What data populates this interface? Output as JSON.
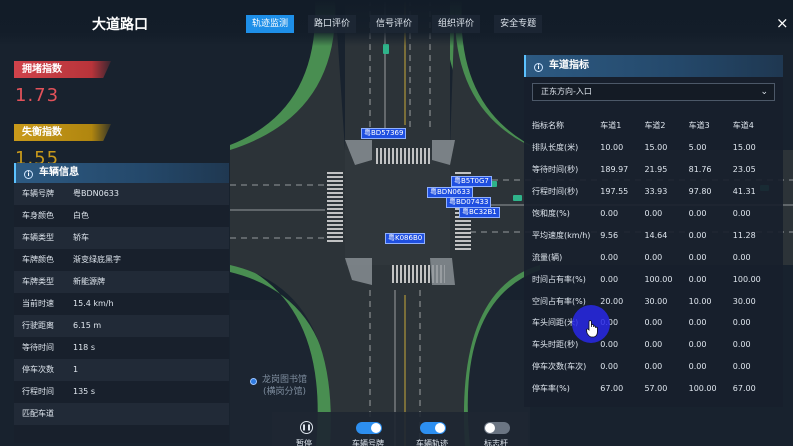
{
  "header": {
    "title": "大道路口",
    "tabs": [
      {
        "label": "轨迹监测",
        "active": true
      },
      {
        "label": "路口评价",
        "active": false
      },
      {
        "label": "信号评价",
        "active": false
      },
      {
        "label": "组织评价",
        "active": false
      },
      {
        "label": "安全专题",
        "active": false
      }
    ],
    "close_icon": "×"
  },
  "indices": {
    "congestion": {
      "label": "拥堵指数",
      "value": "1.73",
      "color": "#e2525a"
    },
    "imbalance": {
      "label": "失衡指数",
      "value": "1.55",
      "color": "#c99a1b"
    }
  },
  "vehicle_info": {
    "title": "车辆信息",
    "rows": [
      {
        "k": "车辆号牌",
        "v": "粤BDN0633"
      },
      {
        "k": "车身颜色",
        "v": "白色"
      },
      {
        "k": "车辆类型",
        "v": "轿车"
      },
      {
        "k": "车牌颜色",
        "v": "渐变绿底黑字"
      },
      {
        "k": "车牌类型",
        "v": "新能源牌"
      },
      {
        "k": "当前时速",
        "v": "15.4 km/h"
      },
      {
        "k": "行驶距离",
        "v": "6.15 m"
      },
      {
        "k": "等待时间",
        "v": "118 s"
      },
      {
        "k": "停车次数",
        "v": "1"
      },
      {
        "k": "行程时间",
        "v": "135 s"
      },
      {
        "k": "匹配车道",
        "v": ""
      }
    ]
  },
  "lane_panel": {
    "title": "车道指标",
    "direction": "正东方向-入口",
    "columns": [
      "指标名称",
      "车道1",
      "车道2",
      "车道3",
      "车道4"
    ],
    "rows": [
      [
        "排队长度(米)",
        "10.00",
        "15.00",
        "5.00",
        "15.00"
      ],
      [
        "等待时间(秒)",
        "189.97",
        "21.95",
        "81.76",
        "23.05"
      ],
      [
        "行程时间(秒)",
        "197.55",
        "33.93",
        "97.80",
        "41.31"
      ],
      [
        "饱和度(%)",
        "0.00",
        "0.00",
        "0.00",
        "0.00"
      ],
      [
        "平均速度(km/h)",
        "9.56",
        "14.64",
        "0.00",
        "11.28"
      ],
      [
        "流量(辆)",
        "0.00",
        "0.00",
        "0.00",
        "0.00"
      ],
      [
        "时间占有率(%)",
        "0.00",
        "100.00",
        "0.00",
        "100.00"
      ],
      [
        "空间占有率(%)",
        "20.00",
        "30.00",
        "10.00",
        "30.00"
      ],
      [
        "车头间距(米)",
        "0.00",
        "0.00",
        "0.00",
        "0.00"
      ],
      [
        "车头时距(秒)",
        "0.00",
        "0.00",
        "0.00",
        "0.00"
      ],
      [
        "停车次数(车次)",
        "0.00",
        "0.00",
        "0.00",
        "0.00"
      ],
      [
        "停车率(%)",
        "67.00",
        "57.00",
        "100.00",
        "67.00"
      ]
    ]
  },
  "map": {
    "plates": [
      "粤BD57369",
      "粤B5T0G7",
      "粤BDN0633",
      "粤BD07433",
      "粤BC32B1",
      "粤K086B0"
    ],
    "poi_name": "龙岗图书馆",
    "poi_sub": "(横岗分馆)"
  },
  "toolbar": {
    "items": [
      {
        "label": "暂停",
        "type": "button"
      },
      {
        "label": "车辆号牌",
        "on": true
      },
      {
        "label": "车辆轨迹",
        "on": true
      },
      {
        "label": "标志杆",
        "on": false
      }
    ]
  }
}
